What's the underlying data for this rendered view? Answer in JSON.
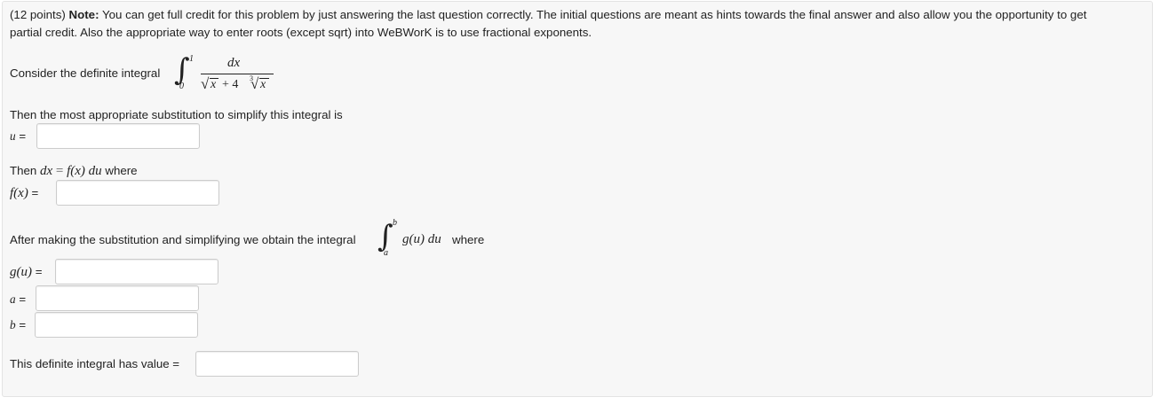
{
  "problem": {
    "points": "(12 points)",
    "note_label": "Note:",
    "note_text_line1": " You can get full credit for this problem by just answering the last question correctly. The initial questions are meant as hints towards the final answer and also allow you the opportunity to get",
    "note_text_line2": "partial credit. Also the appropriate way to enter roots (except sqrt) into WeBWorK is to use fractional exponents."
  },
  "integral_intro": {
    "text": "Consider the definite integral",
    "lower": "0",
    "upper": "1",
    "numerator": "dx",
    "den_sqrt_var": "x",
    "den_plus": "+ 4",
    "den_root_index": "3",
    "den_cbrt_var": "x"
  },
  "substitution": {
    "prompt": "Then the most appropriate substitution to simplify this integral is",
    "u_label": "u",
    "equals": "=",
    "u_value": ""
  },
  "dx_relation": {
    "then": "Then",
    "lhs": "dx",
    "eq": "=",
    "rhs": "f(x) du",
    "where": "where",
    "f_label": "f(x)",
    "equals": "=",
    "f_value": ""
  },
  "after_sub": {
    "text": "After making the substitution and simplifying we obtain the integral",
    "upper": "b",
    "lower": "a",
    "integrand": "g(u) du",
    "where": "where"
  },
  "g_field": {
    "label": "g(u)",
    "equals": "=",
    "value": ""
  },
  "a_field": {
    "label": "a",
    "equals": "=",
    "value": ""
  },
  "b_field": {
    "label": "b",
    "equals": "=",
    "value": ""
  },
  "final": {
    "text": "This definite integral has value =",
    "value": ""
  }
}
